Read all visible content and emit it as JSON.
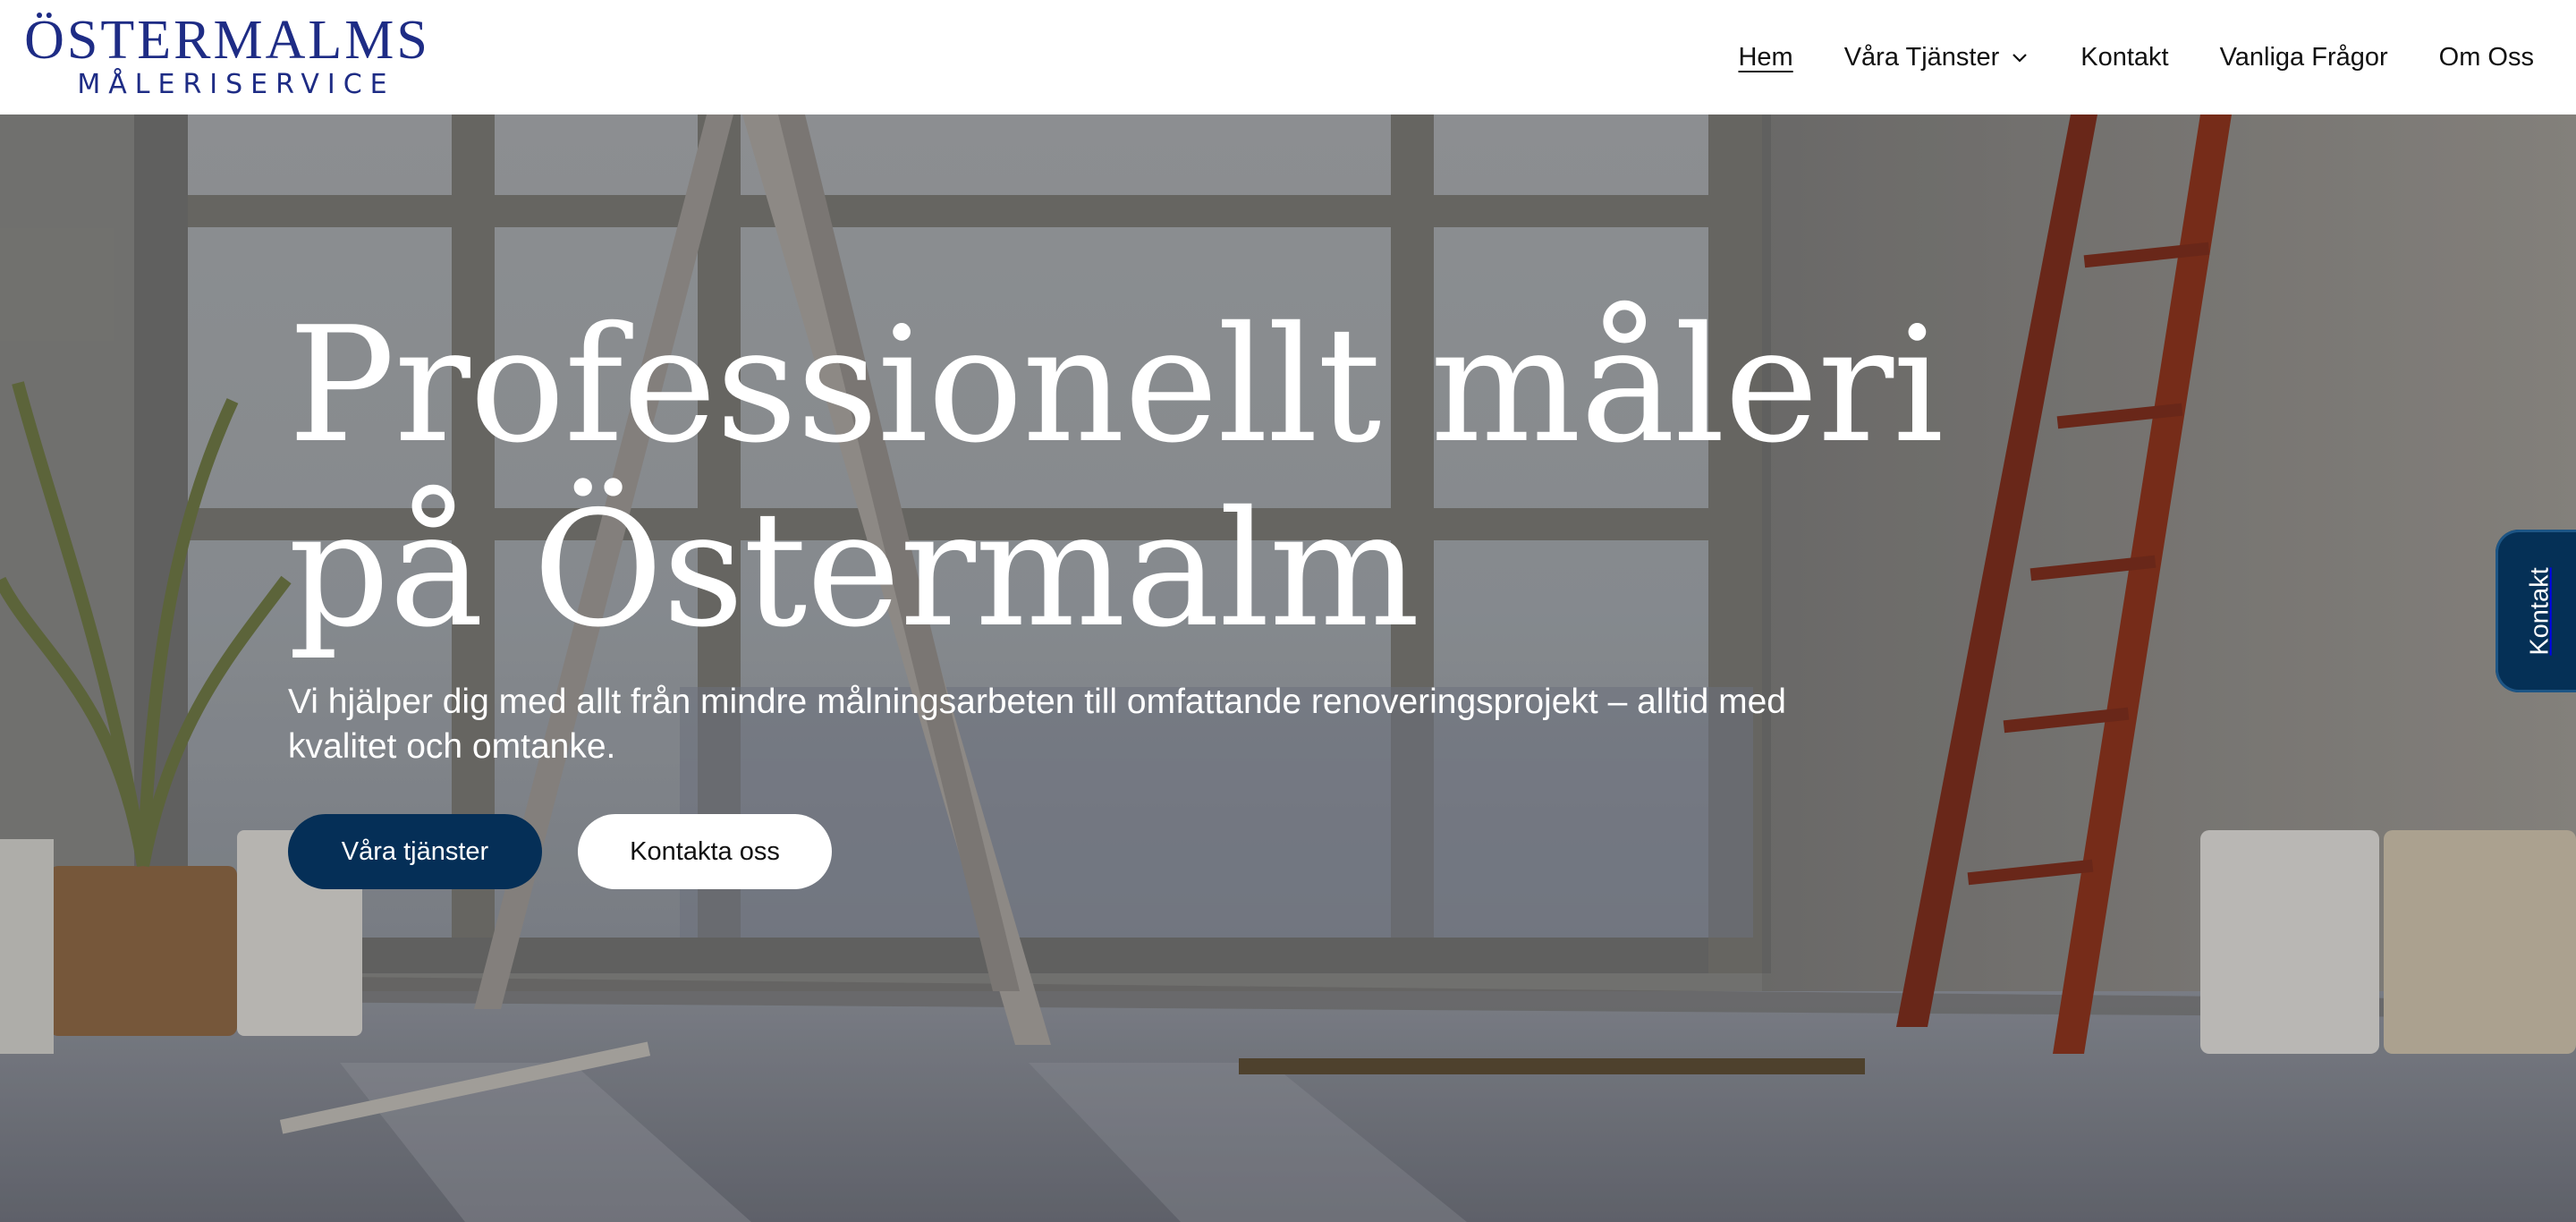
{
  "logo": {
    "main": "ÖSTERMALMS",
    "sub": "MÅLERISERVICE"
  },
  "nav": {
    "items": [
      {
        "label": "Hem",
        "active": true
      },
      {
        "label": "Våra Tjänster",
        "dropdown": true
      },
      {
        "label": "Kontakt"
      },
      {
        "label": "Vanliga Frågor"
      },
      {
        "label": "Om Oss"
      }
    ]
  },
  "hero": {
    "title_line1": "Professionellt måleri",
    "title_line2": "på Östermalm",
    "text": "Vi hjälper dig med allt från mindre målningsarbeten till omfattande renoveringsprojekt – alltid med kvalitet och omtanke.",
    "primary_button": "Våra tjänster",
    "secondary_button": "Kontakta oss",
    "background_image": "room-with-ladders-and-paint-buckets"
  },
  "side_tab": {
    "label": "Kontakt"
  },
  "colors": {
    "brand_blue": "#1e2c85",
    "navy": "#052f57",
    "white": "#ffffff"
  }
}
